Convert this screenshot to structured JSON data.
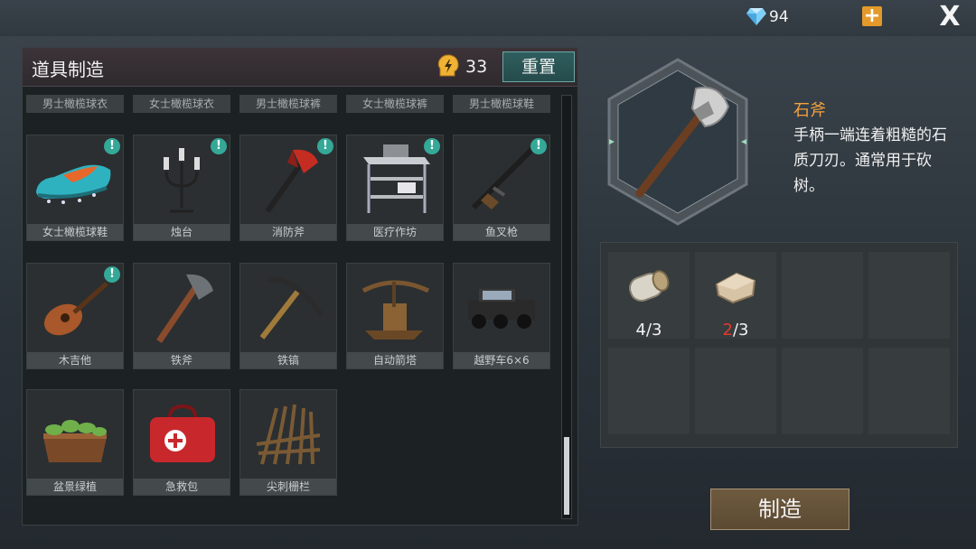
{
  "top": {
    "gems": "94",
    "plus_label": "+",
    "close_label": "X"
  },
  "panel": {
    "title": "道具制造",
    "energy": "33",
    "reset_label": "重置"
  },
  "tabs": [
    "男士橄榄球衣",
    "女士橄榄球衣",
    "男士橄榄球裤",
    "女士橄榄球裤",
    "男士橄榄球鞋"
  ],
  "items": [
    {
      "label": "女士橄榄球鞋",
      "icon": "cleat-shoe-icon",
      "new": true
    },
    {
      "label": "烛台",
      "icon": "candelabra-icon",
      "new": true
    },
    {
      "label": "消防斧",
      "icon": "fire-axe-icon",
      "new": true
    },
    {
      "label": "医疗作坊",
      "icon": "medical-workshop-icon",
      "new": true
    },
    {
      "label": "鱼叉枪",
      "icon": "harpoon-gun-icon",
      "new": true
    },
    {
      "label": "木吉他",
      "icon": "guitar-icon",
      "new": true
    },
    {
      "label": "铁斧",
      "icon": "iron-axe-icon",
      "new": false
    },
    {
      "label": "铁镐",
      "icon": "pickaxe-icon",
      "new": false
    },
    {
      "label": "自动箭塔",
      "icon": "crossbow-turret-icon",
      "new": false
    },
    {
      "label": "越野车6×6",
      "icon": "offroad-truck-icon",
      "new": false
    },
    {
      "label": "盆景绿植",
      "icon": "planter-icon",
      "new": false
    },
    {
      "label": "急救包",
      "icon": "first-aid-bag-icon",
      "new": false
    },
    {
      "label": "尖刺栅栏",
      "icon": "spike-fence-icon",
      "new": false
    }
  ],
  "badge_symbol": "!",
  "detail": {
    "name": "石斧",
    "description": "手柄一端连着粗糙的石质刀刃。通常用于砍树。",
    "icon": "stone-axe-icon"
  },
  "materials": [
    {
      "icon": "log-icon",
      "have": "4",
      "sep": "/",
      "need": "3",
      "sufficient": true
    },
    {
      "icon": "stone-icon",
      "have": "2",
      "sep": "/",
      "need": "3",
      "sufficient": false
    }
  ],
  "craft_label": "制造",
  "colors": {
    "accent_orange": "#f3a23e",
    "badge_teal": "#35a897",
    "insufficient_red": "#e23a2c"
  }
}
